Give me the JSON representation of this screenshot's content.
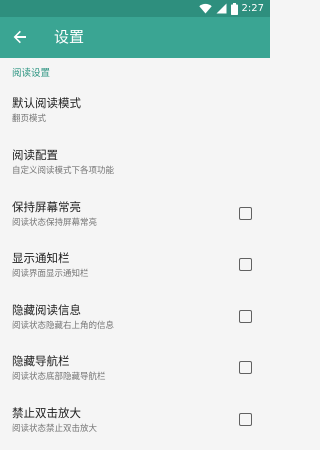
{
  "status_bar": {
    "time": "2:27",
    "icons": [
      "wifi-icon",
      "signal-icon",
      "battery-icon"
    ]
  },
  "app_bar": {
    "back_icon": "arrow-left-icon",
    "title": "设置"
  },
  "section": {
    "title": "阅读设置"
  },
  "preferences": [
    {
      "title": "默认阅读模式",
      "summary": "翻页模式",
      "has_checkbox": false
    },
    {
      "title": "阅读配置",
      "summary": "自定义阅读模式下各项功能",
      "has_checkbox": false
    },
    {
      "title": "保持屏幕常亮",
      "summary": "阅读状态保持屏幕常亮",
      "has_checkbox": true,
      "checked": false
    },
    {
      "title": "显示通知栏",
      "summary": "阅读界面显示通知栏",
      "has_checkbox": true,
      "checked": false
    },
    {
      "title": "隐藏阅读信息",
      "summary": "阅读状态隐藏右上角的信息",
      "has_checkbox": true,
      "checked": false
    },
    {
      "title": "隐藏导航栏",
      "summary": "阅读状态底部隐藏导航栏",
      "has_checkbox": true,
      "checked": false
    },
    {
      "title": "禁止双击放大",
      "summary": "阅读状态禁止双击放大",
      "has_checkbox": true,
      "checked": false
    }
  ],
  "colors": {
    "status_bar": "#2e8f7e",
    "app_bar": "#3aa593",
    "accent": "#2e9582",
    "background": "#f5f5f5"
  }
}
